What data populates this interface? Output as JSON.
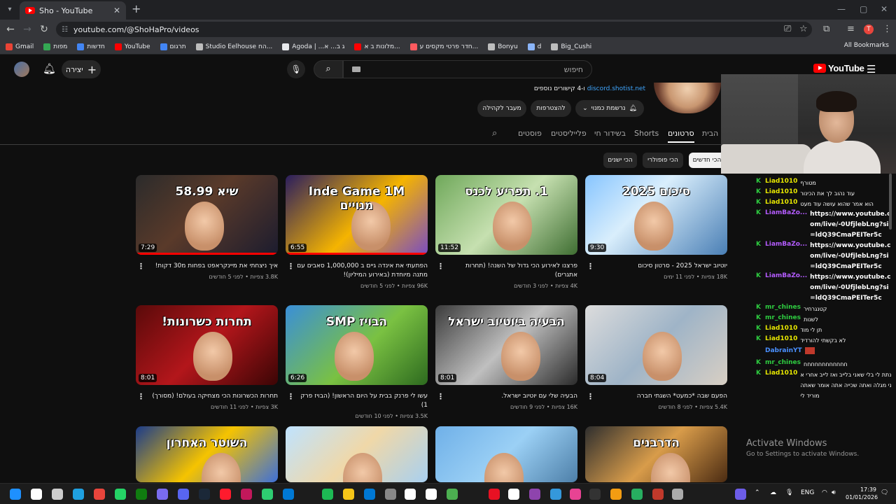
{
  "browser": {
    "tab_title": "Sho - YouTube",
    "url": "youtube.com/@ShoHaPro/videos",
    "profile_initial": "T",
    "bookmarks": [
      {
        "label": "Gmail",
        "color": "#ea4335"
      },
      {
        "label": "מפות",
        "color": "#34a853"
      },
      {
        "label": "חדשות",
        "color": "#4285f4"
      },
      {
        "label": "YouTube",
        "color": "#ff0000"
      },
      {
        "label": "תרגום",
        "color": "#4285f4"
      },
      {
        "label": "Studio Eelhouse הח...",
        "color": "#bdbdbd"
      },
      {
        "label": "Agoda | ...ג ב... א",
        "color": "#e8eaed"
      },
      {
        "label": "מלונות ב א...",
        "color": "#ff0000"
      },
      {
        "label": "חדר פרטי מקסים ע...",
        "color": "#ff5a5f"
      },
      {
        "label": "Bonyu",
        "color": "#bdbdbd"
      },
      {
        "label": "d",
        "color": "#8ab4f8"
      },
      {
        "label": "Big_Cushi",
        "color": "#bdbdbd"
      }
    ],
    "all_bookmarks": "All Bookmarks"
  },
  "header": {
    "create_label": "יצירה",
    "search_placeholder": "חיפוש",
    "logo_text": "YouTube"
  },
  "channel": {
    "links_text": "ו-4 קישורים נוספים",
    "links_link": "discord.shotist.net",
    "buttons": {
      "subscribed": "נרשמת כמנוי",
      "join": "להצטרפות",
      "community": "מעבר לקהילה"
    },
    "tabs": [
      "דף הבית",
      "סרטונים",
      "Shorts",
      "בשידור חי",
      "פלייליסטים",
      "פוסטים"
    ],
    "active_tab": "סרטונים",
    "chips": [
      "הכי חדשים",
      "הכי פופולרי",
      "הכי ישנים"
    ]
  },
  "videos": [
    {
      "title": "יוטיוב ישראל 2025 - סרטון סיכום",
      "meta": "18K צפיות • לפני 11 ימים",
      "duration": "9:30",
      "thumb_text": "סיכום 2025",
      "progress": 0
    },
    {
      "title": "פרצנו לאירוע הכי גדול של השנה! (תחרות אתגרים)",
      "meta": "4K צפיות • לפני 3 חודשים",
      "duration": "11:52",
      "thumb_text": "1. תפריע לכנס",
      "progress": 0
    },
    {
      "title": "הפתעתי את אינדה גיים ב 1,000,000 סאבים עם מתנה מיוחדת (באירוע המיליון)!",
      "meta": "96K צפיות • לפני 5 חודשים",
      "duration": "6:55",
      "thumb_text": "Inde Game 1M מנויים",
      "progress": 1
    },
    {
      "title": "איך ניצחתי את מיינקראפט בפחות מ30 דקות!",
      "meta": "3.8K צפיות • לפני 5 חודשים",
      "duration": "7:29",
      "thumb_text": "שיא 58.99",
      "progress": 1
    },
    {
      "title": "הפעם שבה *כמעט* השגתי חברה",
      "meta": "5.4K צפיות • לפני 8 חודשים",
      "duration": "8:04",
      "thumb_text": "",
      "progress": 0
    },
    {
      "title": "הבעיה שלי עם יוטיוב ישראל.",
      "meta": "16K צפיות • לפני 9 חודשים",
      "duration": "8:01",
      "thumb_text": "הבעיה ביוטיוב ישראל",
      "progress": 0
    },
    {
      "title": "עשו לי פרנק בבית על היום הראשון! (הבויז פרק 1)",
      "meta": "3.5K צפיות • לפני 10 חודשים",
      "duration": "6:26",
      "thumb_text": "הבויז SMP",
      "progress": 0
    },
    {
      "title": "תחרות הכשרונות הכי מצחיקה בעולם! (מסורך)",
      "meta": "3K צפיות • לפני 11 חודשים",
      "duration": "8:01",
      "thumb_text": "תחרות כשרונות!",
      "progress": 0
    },
    {
      "title": "",
      "meta": "",
      "duration": "",
      "thumb_text": "הדרבנים",
      "progress": 0
    },
    {
      "title": "",
      "meta": "",
      "duration": "",
      "thumb_text": "",
      "progress": 0
    },
    {
      "title": "",
      "meta": "",
      "duration": "",
      "thumb_text": "",
      "progress": 0
    },
    {
      "title": "",
      "meta": "",
      "duration": "",
      "thumb_text": "השוטר האחרון",
      "progress": 0
    }
  ],
  "chat": [
    {
      "user": "Liad1010",
      "text": "מטורף",
      "color": "#e6e600",
      "mod": true
    },
    {
      "user": "Liad1010",
      "text": "עוד נהוב לך את הכינור",
      "color": "#e6e600",
      "mod": true
    },
    {
      "user": "Liad1010",
      "text": "הוא אמר שהוא עושה עוד מעט",
      "color": "#e6e600",
      "mod": true
    },
    {
      "user": "LiamBaZo...",
      "text": "https://www.youtube.com/live/-0UfjlebLng?si=ldQ39CmaPEITer5c",
      "color": "#b45cff",
      "mod": true
    },
    {
      "user": "LiamBaZo...",
      "text": "https://www.youtube.com/live/-0UfjlebLng?si=ldQ39CmaPEITer5c",
      "color": "#b45cff",
      "mod": true
    },
    {
      "user": "LiamBaZo...",
      "text": "https://www.youtube.com/live/-0UfjlebLng?si=ldQ39CmaPEITer5c",
      "color": "#b45cff",
      "mod": true
    },
    {
      "user": "mr_chines",
      "text": "קטנגרחיר",
      "color": "#2ecc40",
      "mod": true
    },
    {
      "user": "mr_chines",
      "text": "לשנות",
      "color": "#2ecc40",
      "mod": true
    },
    {
      "user": "Liad1010",
      "text": "תן לי מוד",
      "color": "#e6e600",
      "mod": true
    },
    {
      "user": "Liad1010",
      "text": "לא בקשתי להורדיד",
      "color": "#e6e600",
      "mod": true
    },
    {
      "user": "DabrainYT",
      "text": "",
      "color": "#4a90ff",
      "mod": false
    },
    {
      "user": "mr_chines",
      "text": "חחחחחחחחחחחח",
      "color": "#2ecc40",
      "mod": true
    },
    {
      "user": "Liad1010",
      "text": "נתת לי בלי שאני בלייב ואז לייב אחרי אני מגלה ואתה שכייה אתה אומר שאתה מוריד לי",
      "color": "#e6e600",
      "mod": true
    }
  ],
  "windows": {
    "activate_title": "Activate Windows",
    "activate_sub": "Go to Settings to activate Windows.",
    "lang": "ENG",
    "time": "17:39",
    "date": "01/01/2026"
  }
}
